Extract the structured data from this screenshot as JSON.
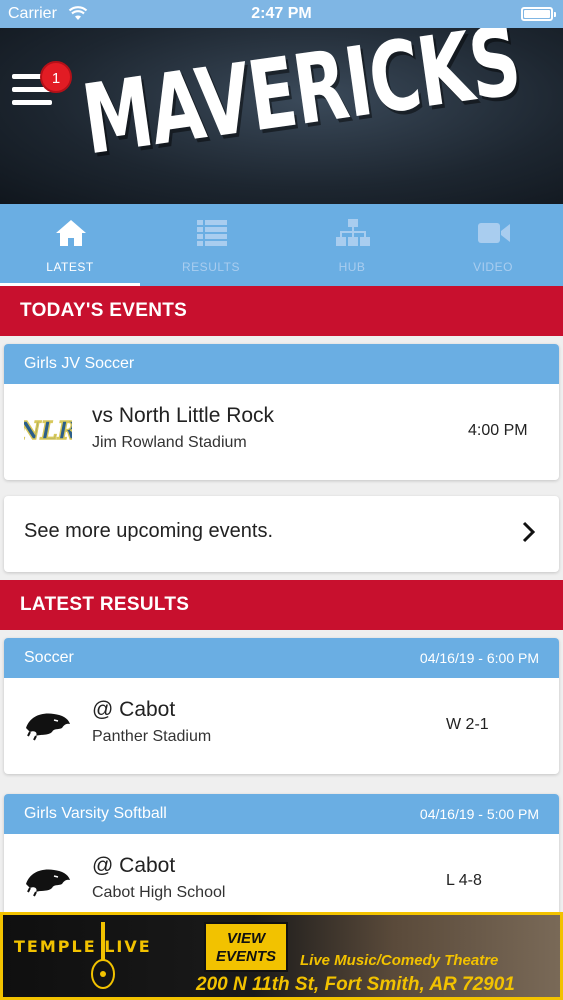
{
  "status_bar": {
    "carrier": "Carrier",
    "time": "2:47 PM",
    "battery_level": 1.0
  },
  "header": {
    "brand": "MAVERICKS",
    "menu_badge": "1"
  },
  "tabs": [
    {
      "label": "LATEST",
      "icon": "home-icon",
      "active": true
    },
    {
      "label": "RESULTS",
      "icon": "list-icon",
      "active": false
    },
    {
      "label": "HUB",
      "icon": "hierarchy-icon",
      "active": false
    },
    {
      "label": "VIDEO",
      "icon": "video-camera-icon",
      "active": false
    }
  ],
  "todays_events": {
    "heading": "TODAY'S EVENTS",
    "events": [
      {
        "sport": "Girls JV Soccer",
        "opponent_logo": "NLR",
        "title": "vs North Little Rock",
        "venue": "Jim Rowland Stadium",
        "time": "4:00 PM"
      }
    ],
    "see_more": "See more upcoming events."
  },
  "latest_results": {
    "heading": "LATEST RESULTS",
    "results": [
      {
        "sport": "Soccer",
        "datetime": "04/16/19 - 6:00 PM",
        "opponent_logo": "panther-logo",
        "title": "@ Cabot",
        "venue": "Panther Stadium",
        "score": "W 2-1"
      },
      {
        "sport": "Girls Varsity Softball",
        "datetime": "04/16/19 - 5:00 PM",
        "opponent_logo": "panther-logo",
        "title": "@ Cabot",
        "venue": "Cabot High School",
        "score": "L 4-8"
      }
    ]
  },
  "ad": {
    "brand": "TEMPLE LIVE",
    "button_line1": "VIEW",
    "button_line2": "EVENTS",
    "tagline": "Live Music/Comedy Theatre",
    "address": "200 N 11th St, Fort Smith, AR 72901",
    "accent_color": "#f2c200"
  },
  "colors": {
    "primary_blue": "#6aaee3",
    "primary_red": "#c8102e"
  }
}
